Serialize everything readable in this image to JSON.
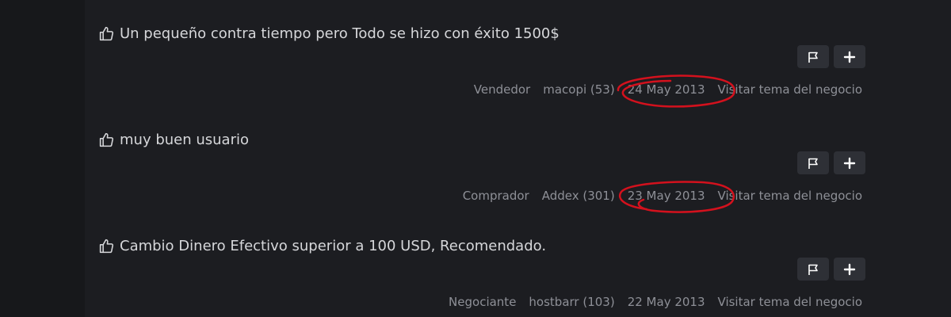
{
  "feedback": [
    {
      "comment": "Un pequeño contra tiempo pero Todo se hizo con éxito 1500$",
      "role": "Vendedor",
      "user": "macopi (53)",
      "date": "24 May 2013",
      "link": "Visitar tema del negocio",
      "circled": true
    },
    {
      "comment": "muy buen usuario",
      "role": "Comprador",
      "user": "Addex (301)",
      "date": "23 May 2013",
      "link": "Visitar tema del negocio",
      "circled": true
    },
    {
      "comment": "Cambio Dinero Efectivo superior a 100 USD, Recomendado.",
      "role": "Negociante",
      "user": "hostbarr (103)",
      "date": "22 May 2013",
      "link": "Visitar tema del negocio",
      "circled": false
    }
  ],
  "icons": {
    "thumb": "thumbs-up-icon",
    "flag": "flag-icon",
    "plus": "plus-icon"
  },
  "colors": {
    "background": "#1c1d21",
    "sidebar": "#17181b",
    "button": "#2e3036",
    "text": "#d6d7da",
    "muted": "#8e9097",
    "annotation": "#d3111d"
  }
}
